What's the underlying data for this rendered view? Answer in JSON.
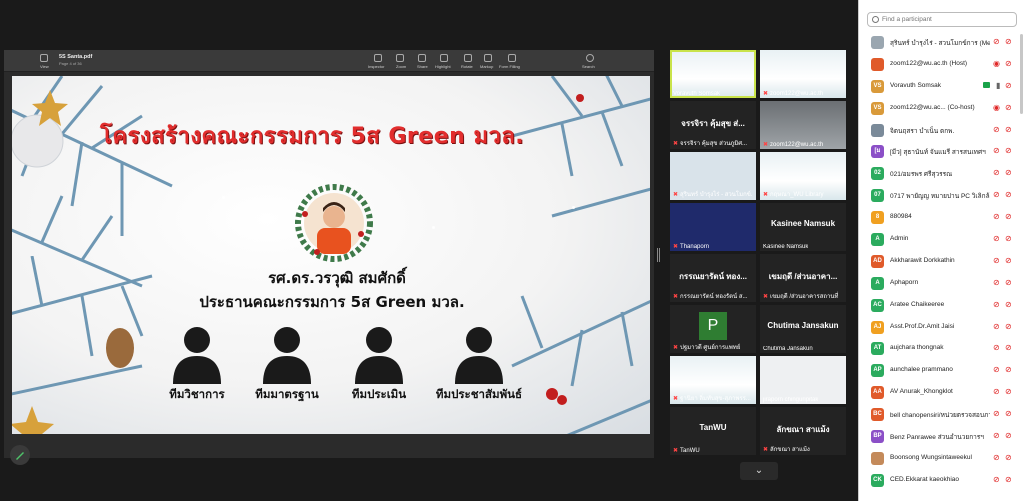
{
  "pdf": {
    "file_name": "5S Santa.pdf",
    "page_label": "Page 4 of 36",
    "toolbar": [
      "View",
      "Inspector",
      "Zoom",
      "Share",
      "Highlight",
      "Rotate",
      "Markup",
      "Form Filling",
      "Search"
    ]
  },
  "slide": {
    "title": "โครงสร้างคณะกรรมการ 5ส Green มวล.",
    "person_name": "รศ.ดร.วรวุฒิ สมศักดิ์",
    "person_role": "ประธานคณะกรรมการ 5ส Green มวล.",
    "teams": [
      "ทีมวิชาการ",
      "ทีมมาตรฐาน",
      "ทีมประเมิน",
      "ทีมประชาสัมพันธ์"
    ]
  },
  "gallery": {
    "tiles": [
      {
        "name": "Voravuth Somsak",
        "center": "",
        "style": "xmas",
        "active": true,
        "muted": false
      },
      {
        "name": "zoom122@wu.ac.th",
        "center": "",
        "style": "xmas",
        "active": false,
        "muted": true
      },
      {
        "name": "จรรจิรา คุ้มสุข ส่วนภูมิศ...",
        "center": "จรรจิรา คุ้มสุข ส่...",
        "style": "dark",
        "active": false,
        "muted": true
      },
      {
        "name": "zoom122@wu.ac.th",
        "center": "",
        "style": "room",
        "active": false,
        "muted": true
      },
      {
        "name": "สุรินทร์ บำรุงไร่ - สวนโมกข์...",
        "center": "",
        "style": "avatar",
        "active": false,
        "muted": true
      },
      {
        "name": "กฤษณา_WU Library",
        "center": "",
        "style": "xmas",
        "active": false,
        "muted": true
      },
      {
        "name": "Thanaporn",
        "center": "",
        "style": "blue",
        "active": false,
        "muted": true
      },
      {
        "name": "Kasinee Namsuk",
        "center": "Kasinee Namsuk",
        "style": "dark",
        "active": false,
        "muted": false
      },
      {
        "name": "กรรณยารัตน์ ทองรัตน์ ส...",
        "center": "กรรณยารัตน์ ทอง...",
        "style": "dark",
        "active": false,
        "muted": true
      },
      {
        "name": "เขมฤดี /ส่วนอาคารสถานที่",
        "center": "เขมฤดี /ส่วนอาคา...",
        "style": "dark",
        "active": false,
        "muted": true
      },
      {
        "name": "ปฐมาวดี ศูนย์การแพทย์",
        "center": "",
        "style": "p",
        "active": false,
        "muted": true
      },
      {
        "name": "Chutima Jansakun",
        "center": "Chutima Jansakun",
        "style": "dark",
        "active": false,
        "muted": false
      },
      {
        "name": "ฐานิยา ลิ่มทับสุข-สุภาพรร...",
        "center": "",
        "style": "xmas",
        "active": false,
        "muted": true
      },
      {
        "name": "jiraporn chinguripitak",
        "center": "",
        "style": "woman",
        "active": false,
        "muted": false
      },
      {
        "name": "TanWU",
        "center": "TanWU",
        "style": "dark",
        "active": false,
        "muted": true
      },
      {
        "name": "ลักขณา สาแม้ง",
        "center": "ลักขณา สาแม้ง",
        "style": "dark",
        "active": false,
        "muted": true
      }
    ]
  },
  "participants": {
    "search_placeholder": "Find a participant",
    "list": [
      {
        "initials": "",
        "color": "#9aa6b0",
        "name": "สุรินทร์ บำรุงไร่ - สวนโมกข์การ (Me)",
        "status": "muted"
      },
      {
        "initials": "",
        "color": "#e05a2a",
        "name": "zoom122@wu.ac.th (Host)",
        "status": "video-off"
      },
      {
        "initials": "VS",
        "color": "#d99a3a",
        "name": "Voravuth Somsak",
        "status": "on"
      },
      {
        "initials": "VS",
        "color": "#d99a3a",
        "name": "zoom122@wu.ac... (Co-host)",
        "status": "video-off"
      },
      {
        "initials": "",
        "color": "#7a8a99",
        "name": "จิตนฤสรา บำเน็น ตกพ.",
        "status": "muted"
      },
      {
        "initials": "[ม",
        "color": "#8b4fc7",
        "name": "[มีว] สุธานันท์ จันแมรี สารสนเทศฯ",
        "status": "muted"
      },
      {
        "initials": "02",
        "color": "#2bab5e",
        "name": "021/อมรพร ศรีสุวรรณ",
        "status": "muted"
      },
      {
        "initials": "07",
        "color": "#2bab5e",
        "name": "0717 พายัญญ หมายปาน PC วิเลิกล้องค่ะ",
        "status": "muted"
      },
      {
        "initials": "8",
        "color": "#f0a020",
        "name": "880984",
        "status": "muted"
      },
      {
        "initials": "A",
        "color": "#2bab5e",
        "name": "Admin",
        "status": "muted"
      },
      {
        "initials": "AD",
        "color": "#e05a2a",
        "name": "Akkharawit Dorkkathin",
        "status": "muted"
      },
      {
        "initials": "A",
        "color": "#2bab5e",
        "name": "Aphaporn",
        "status": "muted"
      },
      {
        "initials": "AC",
        "color": "#2bab5e",
        "name": "Aratee Chaikeeree",
        "status": "muted"
      },
      {
        "initials": "AJ",
        "color": "#f0a020",
        "name": "Asst.Prof.Dr.Amit Jaisi",
        "status": "muted"
      },
      {
        "initials": "AT",
        "color": "#2bab5e",
        "name": "aujchara thongnak",
        "status": "muted"
      },
      {
        "initials": "AP",
        "color": "#2bab5e",
        "name": "aunchalee prammano",
        "status": "muted"
      },
      {
        "initials": "AA",
        "color": "#e05a2a",
        "name": "AV Anurak_Khongklot",
        "status": "muted"
      },
      {
        "initials": "BC",
        "color": "#e05a2a",
        "name": "bell chanopensiri/หน่วยตรวจสอบภายใน",
        "status": "muted"
      },
      {
        "initials": "BP",
        "color": "#8b4fc7",
        "name": "Benz Panrawee ส่วนอำนวยการฯ",
        "status": "muted"
      },
      {
        "initials": "",
        "color": "#c48a5a",
        "name": "Boonsong Wungsintaweekul",
        "status": "muted"
      },
      {
        "initials": "CK",
        "color": "#2bab5e",
        "name": "CED.Ekkarat kaeokhiao",
        "status": "muted"
      }
    ]
  },
  "controls": {
    "gallery_next": "⌄"
  }
}
